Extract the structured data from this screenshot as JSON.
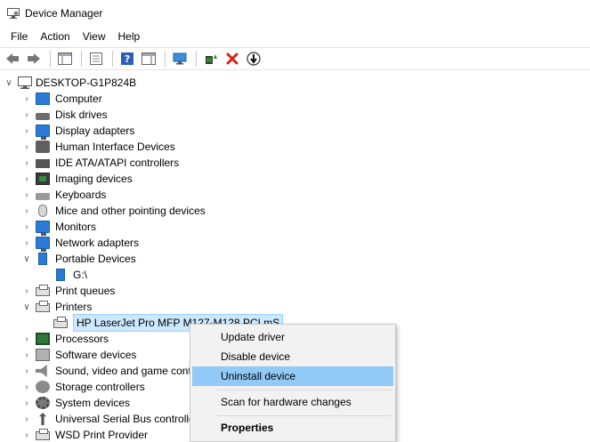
{
  "window": {
    "title": "Device Manager"
  },
  "menu": [
    "File",
    "Action",
    "View",
    "Help"
  ],
  "toolbar": {
    "buttons": [
      "back-icon",
      "forward-icon",
      "show-hide-tree-icon",
      "properties-icon",
      "help-icon",
      "action-pane-icon",
      "monitor-icon",
      "update-driver-icon",
      "uninstall-icon",
      "scan-hardware-icon"
    ],
    "colors": {
      "delete": "#d62020",
      "update": "#2d8a2d",
      "help": "#2b5fb8"
    }
  },
  "tree": {
    "root": "DESKTOP-G1P824B",
    "items": [
      {
        "label": "Computer",
        "expanded": false,
        "icon": "computer-icon"
      },
      {
        "label": "Disk drives",
        "expanded": false,
        "icon": "disk-drive-icon"
      },
      {
        "label": "Display adapters",
        "expanded": false,
        "icon": "display-adapter-icon"
      },
      {
        "label": "Human Interface Devices",
        "expanded": false,
        "icon": "hid-icon"
      },
      {
        "label": "IDE ATA/ATAPI controllers",
        "expanded": false,
        "icon": "ide-controller-icon"
      },
      {
        "label": "Imaging devices",
        "expanded": false,
        "icon": "imaging-device-icon"
      },
      {
        "label": "Keyboards",
        "expanded": false,
        "icon": "keyboard-icon"
      },
      {
        "label": "Mice and other pointing devices",
        "expanded": false,
        "icon": "mouse-icon"
      },
      {
        "label": "Monitors",
        "expanded": false,
        "icon": "monitor-device-icon"
      },
      {
        "label": "Network adapters",
        "expanded": false,
        "icon": "network-adapter-icon"
      },
      {
        "label": "Portable Devices",
        "expanded": true,
        "icon": "portable-device-icon"
      },
      {
        "label": "G:\\",
        "child": true,
        "icon": "portable-drive-icon"
      },
      {
        "label": "Print queues",
        "expanded": false,
        "icon": "print-queue-icon"
      },
      {
        "label": "Printers",
        "expanded": true,
        "icon": "printer-icon"
      },
      {
        "label": "HP LaserJet Pro MFP M127-M128 PCLmS",
        "child": true,
        "selected": true,
        "icon": "printer-device-icon"
      },
      {
        "label": "Processors",
        "expanded": false,
        "icon": "processor-icon"
      },
      {
        "label": "Software devices",
        "expanded": false,
        "icon": "software-device-icon"
      },
      {
        "label": "Sound, video and game controllers",
        "expanded": false,
        "icon": "sound-icon"
      },
      {
        "label": "Storage controllers",
        "expanded": false,
        "icon": "storage-controller-icon"
      },
      {
        "label": "System devices",
        "expanded": false,
        "icon": "system-device-icon"
      },
      {
        "label": "Universal Serial Bus controllers",
        "expanded": false,
        "icon": "usb-icon"
      },
      {
        "label": "WSD Print Provider",
        "expanded": false,
        "icon": "wsd-print-icon"
      }
    ]
  },
  "context_menu": {
    "items": [
      {
        "label": "Update driver"
      },
      {
        "label": "Disable device"
      },
      {
        "label": "Uninstall device",
        "highlighted": true
      },
      {
        "label": "Scan for hardware changes"
      },
      {
        "label": "Properties",
        "bold": true
      }
    ]
  }
}
